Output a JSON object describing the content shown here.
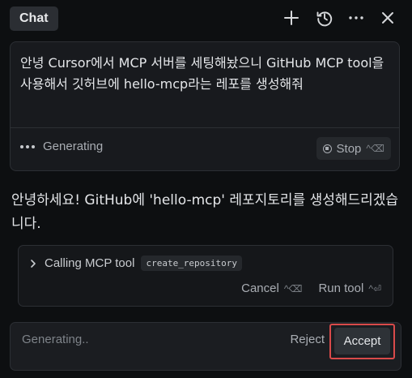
{
  "header": {
    "tab_label": "Chat",
    "icons": [
      "plus-icon",
      "history-icon",
      "more-icon",
      "close-icon"
    ]
  },
  "user_message": {
    "text": "안녕 Cursor에서 MCP 서버를 세팅해놨으니 GitHub MCP tool을 사용해서 깃허브에 hello-mcp라는 레포를 생성해줘",
    "status": "Generating",
    "stop_label": "Stop",
    "stop_shortcut": "^⌫"
  },
  "assistant_message": {
    "text": "안녕하세요! GitHub에 'hello-mcp' 레포지토리를 생성해드리겠습니다."
  },
  "tool_call": {
    "label": "Calling MCP tool",
    "tool_name": "create_repository",
    "cancel_label": "Cancel",
    "cancel_shortcut": "^⌫",
    "run_label": "Run tool",
    "run_shortcut": "^⏎"
  },
  "input_bar": {
    "placeholder": "Generating..",
    "reject_label": "Reject",
    "accept_label": "Accept"
  },
  "colors": {
    "background": "#0d0f11",
    "card": "#181a1e",
    "highlight": "#d94a4a"
  }
}
